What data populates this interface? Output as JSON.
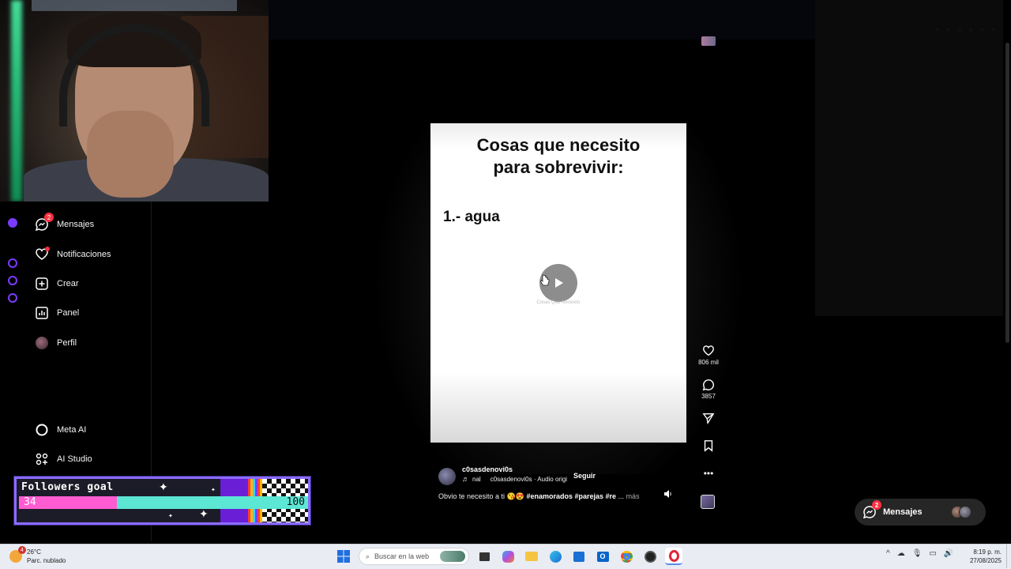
{
  "sidebar": {
    "items": [
      {
        "label": "Mensajes",
        "badge": "2",
        "icon": "messenger-icon"
      },
      {
        "label": "Notificaciones",
        "icon": "heart-icon"
      },
      {
        "label": "Crear",
        "icon": "plus-square-icon"
      },
      {
        "label": "Panel",
        "icon": "chart-icon"
      },
      {
        "label": "Perfil",
        "icon": "avatar-icon"
      },
      {
        "label": "Meta AI",
        "icon": "meta-ai-ring-icon"
      },
      {
        "label": "AI Studio",
        "icon": "ai-studio-icon"
      }
    ]
  },
  "goal": {
    "title": "Followers goal",
    "current": "34",
    "target": "100",
    "progress_fraction": 0.34,
    "fill_color": "#ff5cd1",
    "track_color": "#5ce6d4"
  },
  "reel": {
    "title_line1": "Cosas que necesito",
    "title_line2": "para sobrevivir:",
    "item": "1.- agua",
    "play_caption": "Cosas Que Necesito"
  },
  "actions": {
    "likes": "806 mil",
    "comments": "3857"
  },
  "post": {
    "username": "c0sasdenovi0s",
    "audio_prefix": "nal",
    "audio": "c0sasdenovi0s · Audio origi",
    "follow_label": "Seguir",
    "caption_text": "Obvio te necesito a ti 😘😍 ",
    "caption_tags": "#enamorados #parejas #re",
    "caption_ellipsis": " ... ",
    "more_label": "más"
  },
  "messages_pill": {
    "label": "Mensajes",
    "badge": "2"
  },
  "taskbar": {
    "temperature": "26°C",
    "weather": "Parc. nublado",
    "weather_badge": "4",
    "search_placeholder": "Buscar en la web",
    "time": "8:19 p. m.",
    "date": "27/08/2025"
  },
  "colors": {
    "accent_purple": "#7a3cff",
    "badge_red": "#ff3040"
  }
}
